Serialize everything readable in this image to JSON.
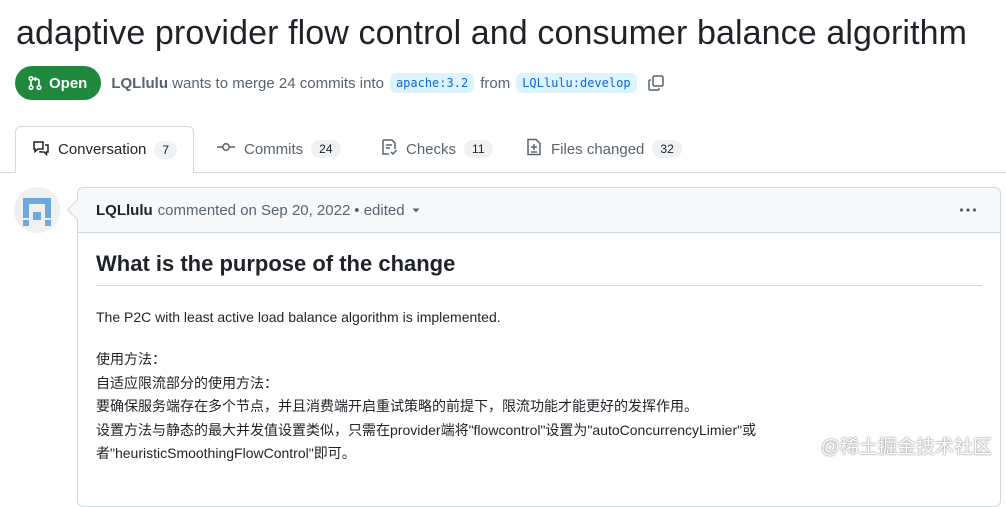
{
  "pr": {
    "title": "adaptive provider flow control and consumer balance algorithm",
    "state": "Open",
    "author": "LQLlulu",
    "merge_text": "wants to merge 24 commits into",
    "base_branch": "apache:3.2",
    "from_text": "from",
    "head_branch": "LQLlulu:develop"
  },
  "tabs": [
    {
      "label": "Conversation",
      "count": "7",
      "icon": "comment-discussion-icon"
    },
    {
      "label": "Commits",
      "count": "24",
      "icon": "git-commit-icon"
    },
    {
      "label": "Checks",
      "count": "11",
      "icon": "checklist-icon"
    },
    {
      "label": "Files changed",
      "count": "32",
      "icon": "file-diff-icon"
    }
  ],
  "comment": {
    "author": "LQLlulu",
    "action": "commented on Sep 20, 2022",
    "edited": "• edited",
    "heading": "What is the purpose of the change",
    "intro": "The P2C with least active load balance algorithm is implemented.",
    "lines": [
      "使用方法：",
      "自适应限流部分的使用方法：",
      "要确保服务端存在多个节点，并且消费端开启重试策略的前提下，限流功能才能更好的发挥作用。",
      "设置方法与静态的最大并发值设置类似，只需在provider端将\"flowcontrol\"设置为\"autoConcurrencyLimier\"或",
      "者\"heuristicSmoothingFlowControl\"即可。"
    ]
  },
  "watermark": "@稀土掘金技术社区",
  "colors": {
    "open_green": "#1f883d",
    "link_blue": "#0969da",
    "branch_bg": "#ddf4ff",
    "muted": "#59636e",
    "border": "#d1d9e0"
  }
}
